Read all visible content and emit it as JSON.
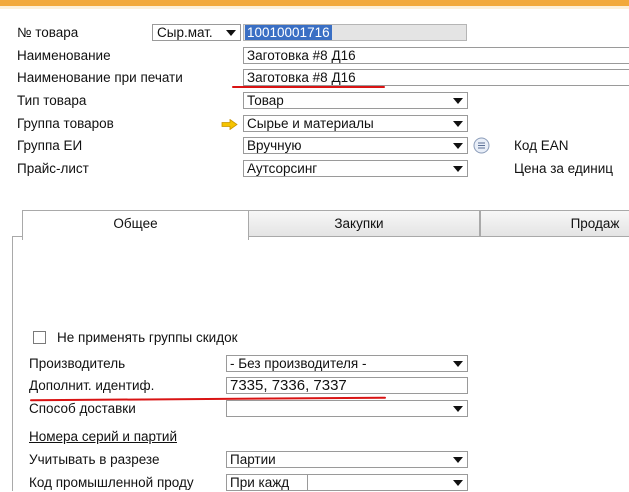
{
  "header": {
    "item_no_label": "№ товара",
    "item_no_series": "Сыр.мат.",
    "item_no_value": "10010001716",
    "name_label": "Наименование",
    "name_value": "Заготовка #8 Д16",
    "print_name_label": "Наименование при печати",
    "print_name_value": "Заготовка #8 Д16",
    "item_type_label": "Тип товара",
    "item_type_value": "Товар",
    "item_group_label": "Группа товаров",
    "item_group_value": "Сырье и материалы",
    "uom_group_label": "Группа ЕИ",
    "uom_group_value": "Вручную",
    "price_list_label": "Прайс-лист",
    "price_list_value": "Аутсорсинг",
    "ean_label": "Код EAN",
    "unit_price_label": "Цена за единиц"
  },
  "tabs": [
    {
      "label": "Общее"
    },
    {
      "label": "Закупки"
    },
    {
      "label": "Продаж"
    }
  ],
  "general": {
    "no_discount_label": "Не применять группы скидок",
    "manufacturer_label": "Производитель",
    "manufacturer_value": "- Без производителя -",
    "additional_id_label": "Дополнит. идентиф.",
    "additional_id_value": "7335, 7336, 7337",
    "shipping_label": "Способ доставки",
    "shipping_value": "",
    "serials_label": "Номера серий и партий",
    "manage_by_label": "Учитывать в разрезе",
    "manage_by_value": "Партии",
    "industry_code_label": "Код промышленной проду",
    "industry_code_value": "При кажд"
  },
  "colors": {
    "accent_orange": "#f2a93b",
    "selection_blue": "#3a6fc4",
    "annotation_red": "#d91414",
    "arrow_yellow": "#f5c400"
  }
}
